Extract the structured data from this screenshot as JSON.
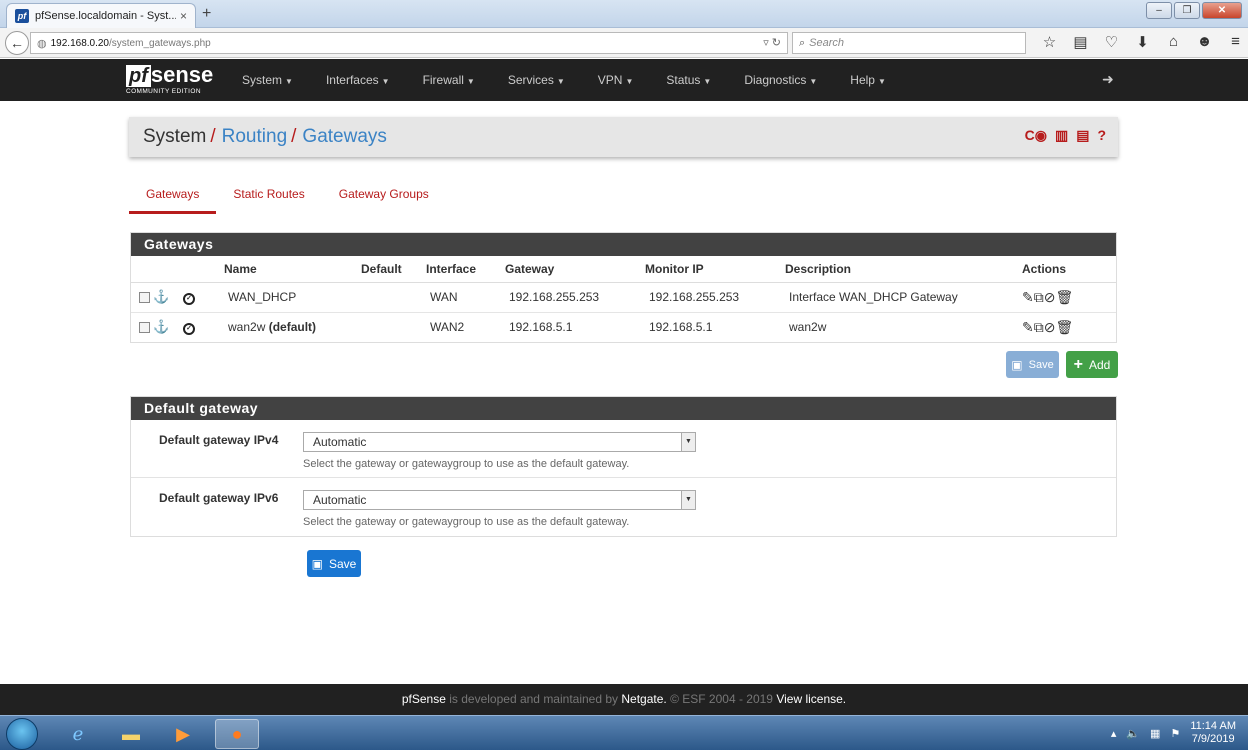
{
  "browser": {
    "tab_title": "pfSense.localdomain - Syst...",
    "tab_close": "×",
    "new_tab": "+",
    "url_host": "192.168.0.20",
    "url_path": "/system_gateways.php",
    "search_placeholder": "Search",
    "window_buttons": [
      "–",
      "❐",
      "✕"
    ]
  },
  "brand": {
    "logo_pf": "pf",
    "logo_sense": "sense",
    "edition": "COMMUNITY EDITION"
  },
  "menu": [
    "System",
    "Interfaces",
    "Firewall",
    "Services",
    "VPN",
    "Status",
    "Diagnostics",
    "Help"
  ],
  "breadcrumb": {
    "c0": "System",
    "c1": "Routing",
    "c2": "Gateways",
    "sep": "/"
  },
  "tabs": [
    "Gateways",
    "Static Routes",
    "Gateway Groups"
  ],
  "gateways_panel": {
    "title": "Gateways",
    "columns": [
      "Name",
      "Default",
      "Interface",
      "Gateway",
      "Monitor IP",
      "Description",
      "Actions"
    ],
    "rows": [
      {
        "name": "WAN_DHCP",
        "name_suffix": "",
        "default": "",
        "interface": "WAN",
        "gateway": "192.168.255.253",
        "monitor_ip": "192.168.255.253",
        "description": "Interface WAN_DHCP Gateway"
      },
      {
        "name": "wan2w",
        "name_suffix": "(default)",
        "default": "",
        "interface": "WAN2",
        "gateway": "192.168.5.1",
        "monitor_ip": "192.168.5.1",
        "description": "wan2w"
      }
    ],
    "save_label": "Save",
    "add_label": "Add"
  },
  "default_gateway": {
    "title": "Default gateway",
    "ipv4_label": "Default gateway IPv4",
    "ipv4_value": "Automatic",
    "ipv6_label": "Default gateway IPv6",
    "ipv6_value": "Automatic",
    "help": "Select the gateway or gatewaygroup to use as the default gateway.",
    "save_label": "Save"
  },
  "footer": {
    "pfsense": "pfSense",
    "text1": " is developed and maintained by ",
    "netgate": "Netgate.",
    "text2": " © ESF 2004 - 2019 ",
    "license": "View license."
  },
  "taskbar": {
    "time": "11:14 AM",
    "date": "7/9/2019"
  }
}
